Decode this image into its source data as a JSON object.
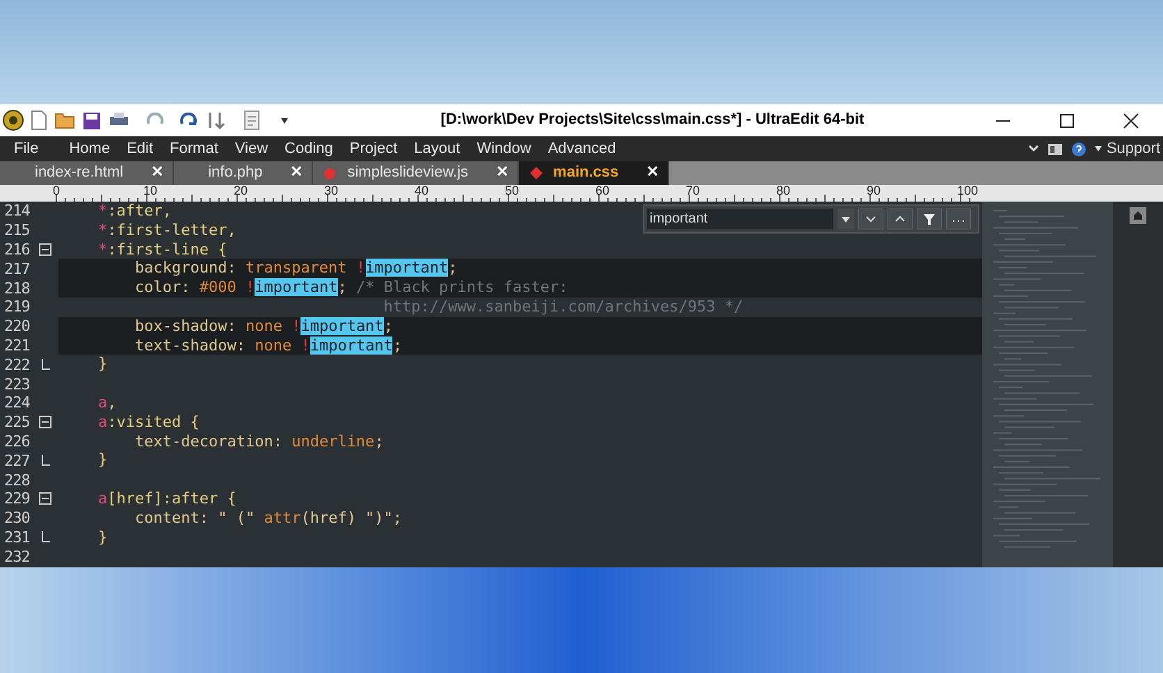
{
  "window": {
    "title": "[D:\\work\\Dev Projects\\Site\\css\\main.css*] - UltraEdit 64-bit"
  },
  "menu": [
    "File",
    "Home",
    "Edit",
    "Format",
    "View",
    "Coding",
    "Project",
    "Layout",
    "Window",
    "Advanced"
  ],
  "menu_right": {
    "label": "Support"
  },
  "tabs": [
    {
      "label": "index-re.html",
      "selected": false,
      "modified": false,
      "close": "✕"
    },
    {
      "label": "info.php",
      "selected": false,
      "modified": false,
      "close": "✕"
    },
    {
      "label": "simpleslideview.js",
      "selected": false,
      "modified": true,
      "close": "✕"
    },
    {
      "label": "main.css",
      "selected": true,
      "modified": true,
      "close": "✕"
    }
  ],
  "ruler": [
    "0",
    "10",
    "20",
    "30",
    "40",
    "50",
    "60",
    "70",
    "80",
    "90",
    "100"
  ],
  "find_bar": {
    "value": "important"
  },
  "lines": [
    {
      "number": "214",
      "collapsible": false,
      "block_end": false,
      "found": false,
      "tokens": [
        {
          "kind": "star",
          "text": "    *"
        },
        {
          "kind": "sel",
          "text": ":after,"
        }
      ]
    },
    {
      "number": "215",
      "collapsible": false,
      "block_end": false,
      "found": false,
      "tokens": [
        {
          "kind": "star",
          "text": "    *"
        },
        {
          "kind": "sel",
          "text": ":first-letter,"
        }
      ]
    },
    {
      "number": "216",
      "collapsible": true,
      "block_end": false,
      "found": false,
      "tokens": [
        {
          "kind": "star",
          "text": "    *"
        },
        {
          "kind": "sel",
          "text": ":first-line {"
        }
      ]
    },
    {
      "number": "217",
      "collapsible": false,
      "block_end": false,
      "found": true,
      "tokens": [
        {
          "kind": "prop",
          "text": "        background: "
        },
        {
          "kind": "value",
          "text": "transparent "
        },
        {
          "kind": "bang",
          "text": "!"
        },
        {
          "kind": "match",
          "text": "important"
        },
        {
          "kind": "prop",
          "text": ";"
        }
      ]
    },
    {
      "number": "218",
      "collapsible": false,
      "block_end": false,
      "found": true,
      "tokens": [
        {
          "kind": "prop",
          "text": "        color: "
        },
        {
          "kind": "value",
          "text": "#000 "
        },
        {
          "kind": "bang",
          "text": "!"
        },
        {
          "kind": "match",
          "text": "important"
        },
        {
          "kind": "prop",
          "text": "; "
        },
        {
          "kind": "comment",
          "text": "/* Black prints faster:"
        }
      ]
    },
    {
      "number": "219",
      "collapsible": false,
      "block_end": false,
      "found": false,
      "tokens": [
        {
          "kind": "comment",
          "text": "                                   http://www.sanbeiji.com/archives/953 */"
        }
      ]
    },
    {
      "number": "220",
      "collapsible": false,
      "block_end": false,
      "found": true,
      "tokens": [
        {
          "kind": "prop",
          "text": "        box-shadow: "
        },
        {
          "kind": "value",
          "text": "none "
        },
        {
          "kind": "bang",
          "text": "!"
        },
        {
          "kind": "match",
          "text": "important"
        },
        {
          "kind": "prop",
          "text": ";"
        }
      ]
    },
    {
      "number": "221",
      "collapsible": false,
      "block_end": false,
      "found": true,
      "tokens": [
        {
          "kind": "prop",
          "text": "        text-shadow: "
        },
        {
          "kind": "value",
          "text": "none "
        },
        {
          "kind": "bang",
          "text": "!"
        },
        {
          "kind": "match",
          "text": "important"
        },
        {
          "kind": "prop",
          "text": ";"
        }
      ]
    },
    {
      "number": "222",
      "collapsible": false,
      "block_end": true,
      "found": false,
      "tokens": [
        {
          "kind": "sel",
          "text": "    }"
        }
      ]
    },
    {
      "number": "223",
      "collapsible": false,
      "block_end": false,
      "found": false
    },
    {
      "number": "224",
      "collapsible": false,
      "block_end": false,
      "found": false,
      "tokens": [
        {
          "kind": "star",
          "text": "    a"
        },
        {
          "kind": "sel",
          "text": ","
        }
      ]
    },
    {
      "number": "225",
      "collapsible": true,
      "block_end": false,
      "found": false,
      "tokens": [
        {
          "kind": "star",
          "text": "    a"
        },
        {
          "kind": "sel",
          "text": ":visited {"
        }
      ]
    },
    {
      "number": "226",
      "collapsible": false,
      "block_end": false,
      "found": false,
      "tokens": [
        {
          "kind": "prop",
          "text": "        text-decoration: "
        },
        {
          "kind": "value",
          "text": "underline"
        },
        {
          "kind": "prop",
          "text": ";"
        }
      ]
    },
    {
      "number": "227",
      "collapsible": false,
      "block_end": true,
      "found": false,
      "tokens": [
        {
          "kind": "sel",
          "text": "    }"
        }
      ]
    },
    {
      "number": "228",
      "collapsible": false,
      "block_end": false,
      "found": false
    },
    {
      "number": "229",
      "collapsible": true,
      "block_end": false,
      "found": false,
      "tokens": [
        {
          "kind": "star",
          "text": "    a"
        },
        {
          "kind": "sel",
          "text": "[href]:after {"
        }
      ]
    },
    {
      "number": "230",
      "collapsible": false,
      "block_end": false,
      "found": false,
      "tokens": [
        {
          "kind": "prop",
          "text": "        content: \" (\" "
        },
        {
          "kind": "value",
          "text": "attr"
        },
        {
          "kind": "prop",
          "text": "(href) \")\";"
        }
      ]
    },
    {
      "number": "231",
      "collapsible": false,
      "block_end": true,
      "found": false,
      "tokens": [
        {
          "kind": "sel",
          "text": "    }"
        }
      ]
    },
    {
      "number": "232",
      "collapsible": false,
      "block_end": false,
      "found": false
    }
  ]
}
